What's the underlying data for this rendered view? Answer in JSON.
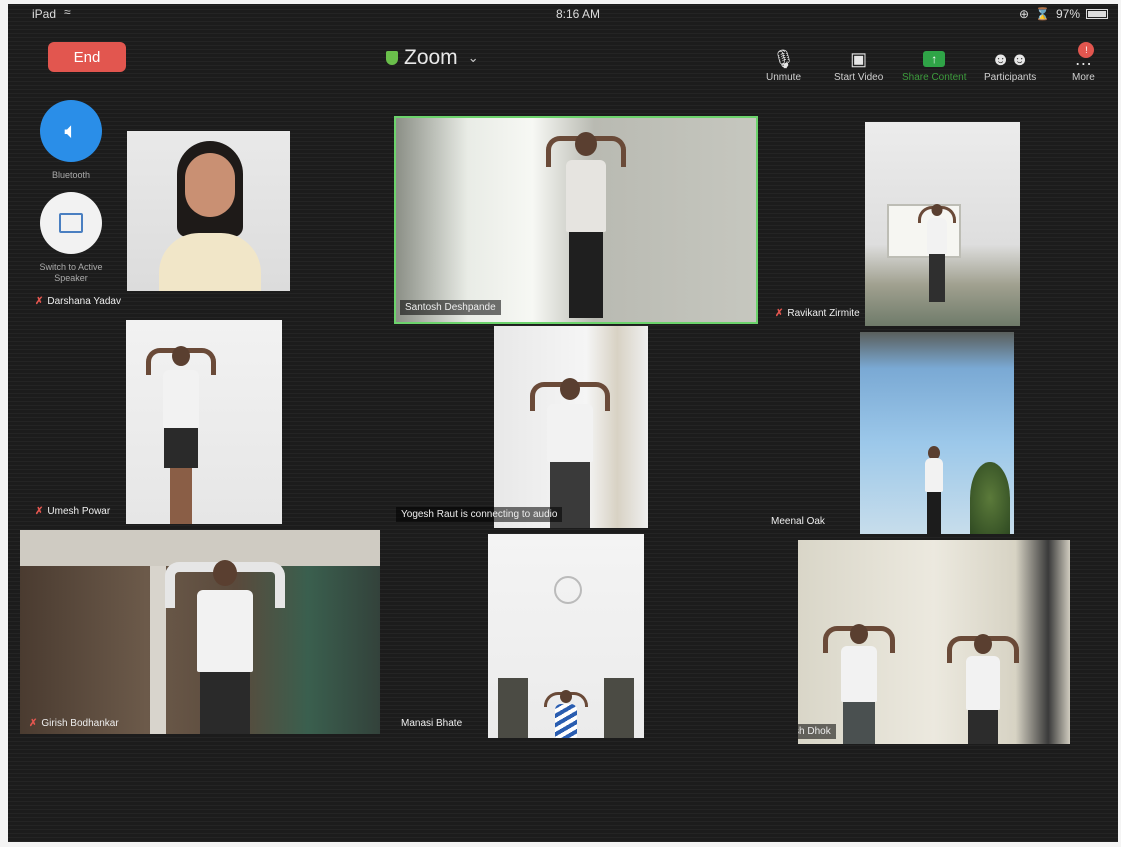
{
  "status_bar": {
    "device": "iPad",
    "time": "8:16 AM",
    "battery": "97%"
  },
  "top_bar": {
    "end_label": "End",
    "meeting_title": "Zoom",
    "buttons": {
      "unmute": "Unmute",
      "start_video": "Start Video",
      "share_content": "Share Content",
      "participants": "Participants",
      "more": "More"
    },
    "more_badge": "!"
  },
  "left_controls": {
    "bluetooth_label": "Bluetooth",
    "switch_speaker_label": "Switch to Active Speaker"
  },
  "participants": [
    {
      "name": "Darshana Yadav",
      "muted": true
    },
    {
      "name": "Santosh Deshpande",
      "muted": false,
      "active_speaker": true
    },
    {
      "name": "Ravikant Zirmite",
      "muted": true
    },
    {
      "name": "Umesh Powar",
      "muted": true
    },
    {
      "name": "Yogesh Raut is connecting to audio",
      "muted": false
    },
    {
      "name": "Meenal Oak",
      "muted": false
    },
    {
      "name": "Girish Bodhankar",
      "muted": true
    },
    {
      "name": "Manasi Bhate",
      "muted": false
    },
    {
      "name": "Mahesh Dhok",
      "muted": false
    }
  ],
  "colors": {
    "end_red": "#e2564f",
    "active_green": "#6cd36c",
    "accent_blue": "#2a8ee8"
  }
}
